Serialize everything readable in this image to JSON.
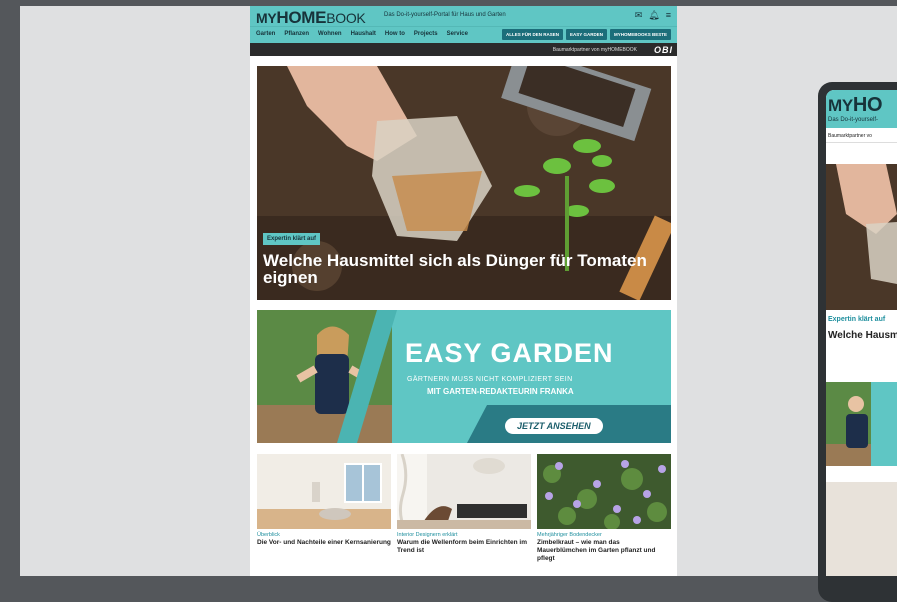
{
  "header": {
    "logo_my": "MY",
    "logo_home": "HOME",
    "logo_book": "BOOK",
    "tagline": "Das Do-it-yourself-Portal für Haus und Garten",
    "icons": [
      "newsletter-icon",
      "bell-icon",
      "menu-icon"
    ]
  },
  "nav": {
    "links": [
      "Garten",
      "Pflanzen",
      "Wohnen",
      "Haushalt",
      "How to",
      "Projects",
      "Service"
    ],
    "pills": [
      "ALLES FÜR DEN RASEN",
      "EASY GARDEN",
      "MYHOMEBOOKS BESTE"
    ]
  },
  "partner": {
    "text": "Baumarktpartner von myHOMEBOOK",
    "obi": "OBI"
  },
  "hero": {
    "kicker": "Expertin klärt auf",
    "headline": "Welche Hausmittel sich als Dünger für Tomaten eignen"
  },
  "banner": {
    "title": "EASY GARDEN",
    "subtitle1": "GÄRTNERN MUSS NICHT KOMPLIZIERT SEIN",
    "subtitle2": "MIT GARTEN-REDAKTEURIN FRANKA",
    "cta": "JETZT ANSEHEN"
  },
  "cards": [
    {
      "kicker": "Überblick",
      "title": "Die Vor- und Nachteile einer Kernsanierung"
    },
    {
      "kicker": "Interior Designern erklärt",
      "title": "Warum die Wellenform beim Einrichten im Trend ist"
    },
    {
      "kicker": "Mehrjähriger Bodendecker",
      "title": "Zimbelkraut – wie man das Mauerblümchen im Garten pflanzt und pflegt"
    }
  ],
  "mobile": {
    "logo_my": "MY",
    "logo_home": "HO",
    "tagline": "Das Do-it-yourself-",
    "partner": "Baumarktpartner vo",
    "kicker": "Expertin klärt auf",
    "title": "Welche Hausm eignen"
  }
}
